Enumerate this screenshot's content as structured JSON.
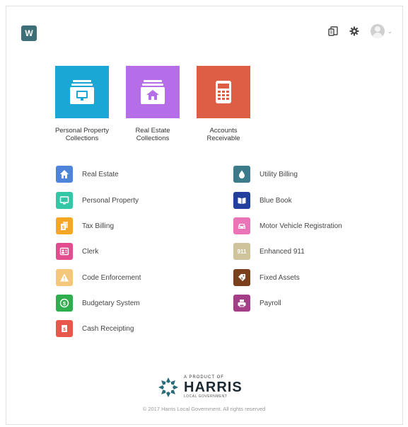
{
  "header": {
    "app_badge": "W",
    "icons": [
      "documents-icon",
      "gear-icon",
      "user-avatar"
    ],
    "accent": "#3d6f79"
  },
  "tiles": [
    {
      "label": "Personal Property\nCollections",
      "color": "#1aa7d6",
      "icon": "computer-drawer-icon"
    },
    {
      "label": "Real Estate\nCollections",
      "color": "#b56ee8",
      "icon": "house-drawer-icon"
    },
    {
      "label": "Accounts\nReceivable",
      "color": "#de5d45",
      "icon": "calculator-icon"
    }
  ],
  "modules_left": [
    {
      "label": "Real Estate",
      "color": "#4f84dc",
      "icon": "house-icon"
    },
    {
      "label": "Personal Property",
      "color": "#33c7a7",
      "icon": "monitor-icon"
    },
    {
      "label": "Tax Billing",
      "color": "#f5a623",
      "icon": "tax-doc-icon"
    },
    {
      "label": "Clerk",
      "color": "#e14d8f",
      "icon": "clerk-icon"
    },
    {
      "label": "Code Enforcement",
      "color": "#f4c77b",
      "icon": "warning-icon"
    },
    {
      "label": "Budgetary System",
      "color": "#2fae4d",
      "icon": "dollar-icon"
    },
    {
      "label": "Cash Receipting",
      "color": "#e8574a",
      "icon": "receipt-icon"
    }
  ],
  "modules_right": [
    {
      "label": "Utility Billing",
      "color": "#3b7b8a",
      "icon": "water-drop-icon"
    },
    {
      "label": "Blue Book",
      "color": "#223f9e",
      "icon": "book-icon"
    },
    {
      "label": "Motor Vehicle Registration",
      "color": "#ea74b7",
      "icon": "car-icon"
    },
    {
      "label": "Enhanced 911",
      "color": "#cfc39c",
      "icon": "911-icon",
      "glyph": "911"
    },
    {
      "label": "Fixed Assets",
      "color": "#7b3f1e",
      "icon": "tag-icon"
    },
    {
      "label": "Payroll",
      "color": "#a33e87",
      "icon": "printer-icon"
    }
  ],
  "footer": {
    "tagline": "A PRODUCT OF",
    "brand": "HARRIS",
    "sub": "LOCAL GOVERNMENT",
    "copyright": "© 2017 Harris Local Government. All rights reserved"
  }
}
